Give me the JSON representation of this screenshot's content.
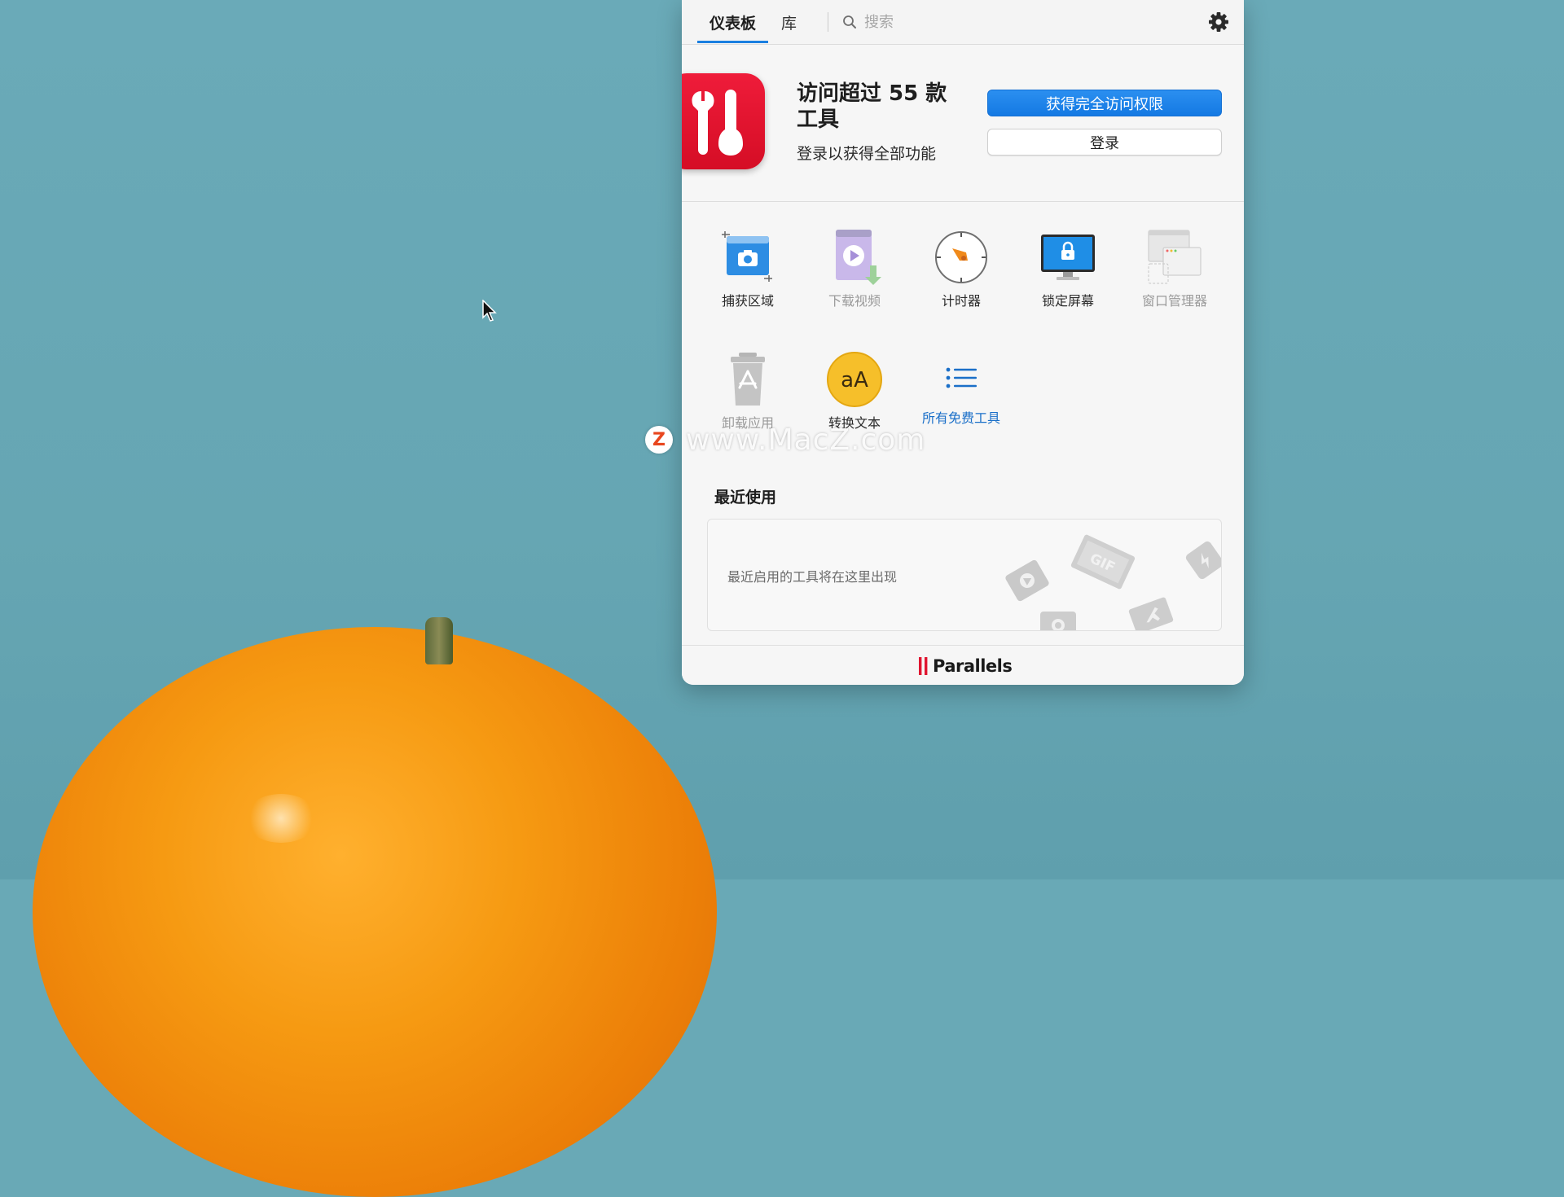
{
  "tabs": {
    "dashboard": "仪表板",
    "library": "库"
  },
  "search": {
    "placeholder": "搜索"
  },
  "hero": {
    "title": "访问超过 55 款工具",
    "subtitle": "登录以获得全部功能",
    "cta_label": "获得完全访问权限",
    "login_label": "登录"
  },
  "tools": [
    {
      "label": "捕获区域",
      "icon": "capture-area-icon",
      "state": "enabled"
    },
    {
      "label": "下载视频",
      "icon": "download-video-icon",
      "state": "disabled"
    },
    {
      "label": "计时器",
      "icon": "timer-icon",
      "state": "enabled"
    },
    {
      "label": "锁定屏幕",
      "icon": "lock-screen-icon",
      "state": "enabled"
    },
    {
      "label": "窗口管理器",
      "icon": "window-manager-icon",
      "state": "disabled"
    },
    {
      "label": "卸载应用",
      "icon": "uninstall-app-icon",
      "state": "disabled"
    },
    {
      "label": "转换文本",
      "icon": "convert-text-icon",
      "state": "enabled",
      "icon_text": "aA"
    },
    {
      "label": "所有免费工具",
      "icon": "list-icon",
      "state": "link"
    }
  ],
  "recent": {
    "title": "最近使用",
    "empty_message": "最近启用的工具将在这里出现",
    "decor_badge": "GIF"
  },
  "footer": {
    "brand": "Parallels"
  },
  "watermark": {
    "badge": "Z",
    "text": "www.MacZ.com"
  },
  "colors": {
    "accent": "#1a7fe0",
    "logo_red": "#e01530",
    "link": "#1a6fc8"
  }
}
